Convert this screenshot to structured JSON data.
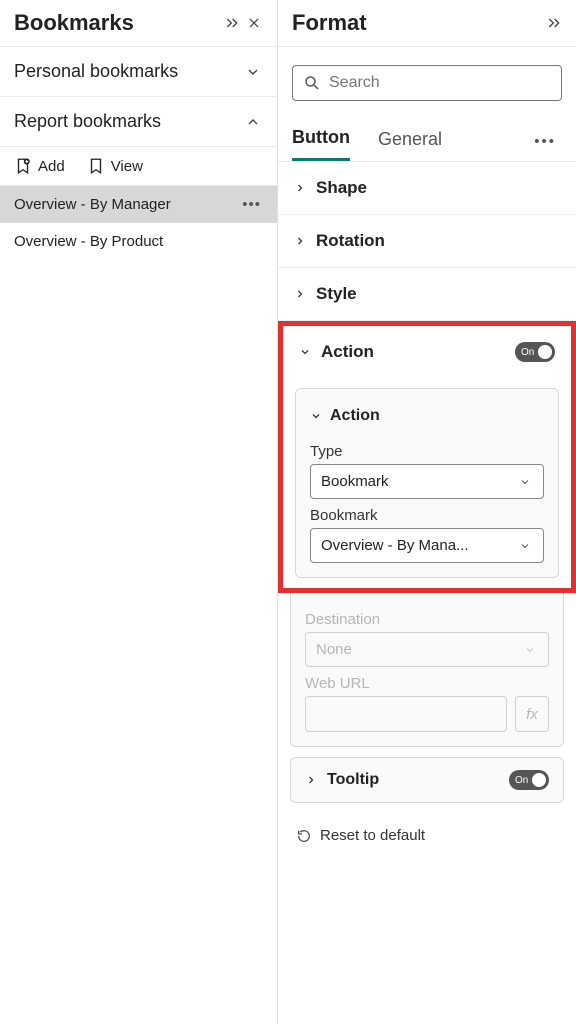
{
  "bookmarks": {
    "title": "Bookmarks",
    "personal_title": "Personal bookmarks",
    "report_title": "Report bookmarks",
    "add_label": "Add",
    "view_label": "View",
    "items": [
      {
        "label": "Overview - By Manager",
        "selected": true
      },
      {
        "label": "Overview - By Product",
        "selected": false
      }
    ]
  },
  "format": {
    "title": "Format",
    "search_placeholder": "Search",
    "tabs": {
      "button": "Button",
      "general": "General"
    },
    "sections": {
      "shape": "Shape",
      "rotation": "Rotation",
      "style": "Style",
      "action": "Action",
      "tooltip": "Tooltip"
    },
    "toggle_on_label": "On",
    "action_card": {
      "header": "Action",
      "type_label": "Type",
      "type_value": "Bookmark",
      "bookmark_label": "Bookmark",
      "bookmark_value": "Overview - By Mana...",
      "destination_label": "Destination",
      "destination_value": "None",
      "weburl_label": "Web URL",
      "fx_label": "fx"
    },
    "reset_label": "Reset to default"
  }
}
